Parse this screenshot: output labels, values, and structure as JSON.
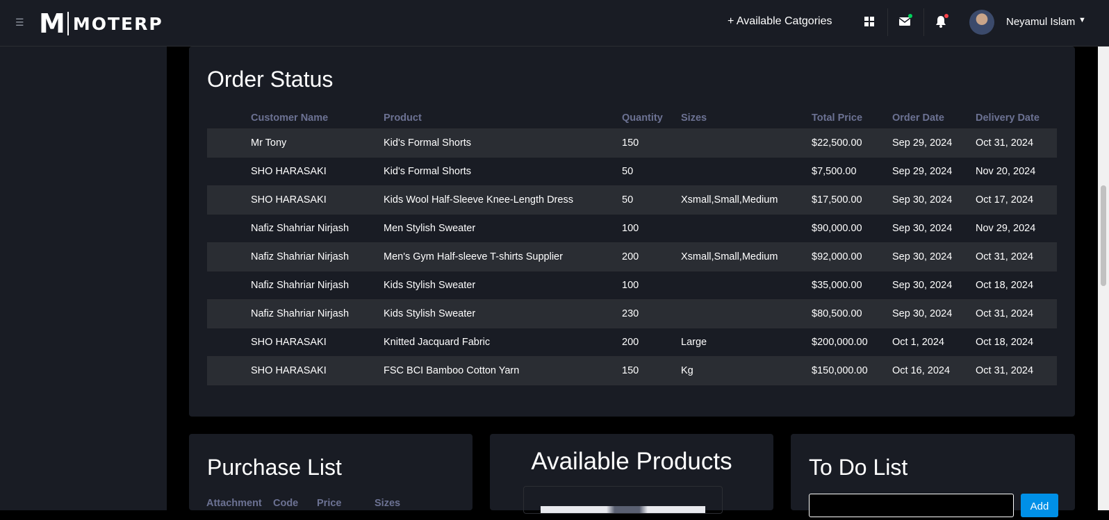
{
  "header": {
    "menu_icon": "hamburger-icon",
    "logo_mark": "M",
    "logo_text": "MOTERP",
    "available_categories": "+ Available Catgories",
    "icons": [
      "grid-icon",
      "mail-icon",
      "bell-icon"
    ],
    "user_name": "Neyamul Islam"
  },
  "order_status": {
    "title": "Order Status",
    "columns": [
      "Customer Name",
      "Product",
      "Quantity",
      "Sizes",
      "Total Price",
      "Order Date",
      "Delivery Date"
    ],
    "rows": [
      {
        "customer": "Mr Tony",
        "product": "Kid's Formal Shorts",
        "quantity": "150",
        "sizes": "",
        "total": "$22,500.00",
        "order_date": "Sep 29, 2024",
        "delivery_date": "Oct 31, 2024"
      },
      {
        "customer": "SHO HARASAKI",
        "product": "Kid's Formal Shorts",
        "quantity": "50",
        "sizes": "",
        "total": "$7,500.00",
        "order_date": "Sep 29, 2024",
        "delivery_date": "Nov 20, 2024"
      },
      {
        "customer": "SHO HARASAKI",
        "product": "Kids Wool Half-Sleeve Knee-Length Dress",
        "quantity": "50",
        "sizes": "Xsmall,Small,Medium",
        "total": "$17,500.00",
        "order_date": "Sep 30, 2024",
        "delivery_date": "Oct 17, 2024"
      },
      {
        "customer": "Nafiz Shahriar Nirjash",
        "product": "Men Stylish Sweater",
        "quantity": "100",
        "sizes": "",
        "total": "$90,000.00",
        "order_date": "Sep 30, 2024",
        "delivery_date": "Nov 29, 2024"
      },
      {
        "customer": "Nafiz Shahriar Nirjash",
        "product": "Men's Gym Half-sleeve T-shirts Supplier",
        "quantity": "200",
        "sizes": "Xsmall,Small,Medium",
        "total": "$92,000.00",
        "order_date": "Sep 30, 2024",
        "delivery_date": "Oct 31, 2024"
      },
      {
        "customer": "Nafiz Shahriar Nirjash",
        "product": "Kids Stylish Sweater",
        "quantity": "100",
        "sizes": "",
        "total": "$35,000.00",
        "order_date": "Sep 30, 2024",
        "delivery_date": "Oct 18, 2024"
      },
      {
        "customer": "Nafiz Shahriar Nirjash",
        "product": "Kids Stylish Sweater",
        "quantity": "230",
        "sizes": "",
        "total": "$80,500.00",
        "order_date": "Sep 30, 2024",
        "delivery_date": "Oct 31, 2024"
      },
      {
        "customer": "SHO HARASAKI",
        "product": "Knitted Jacquard Fabric",
        "quantity": "200",
        "sizes": "Large",
        "total": "$200,000.00",
        "order_date": "Oct 1, 2024",
        "delivery_date": "Oct 18, 2024"
      },
      {
        "customer": "SHO HARASAKI",
        "product": "FSC BCI Bamboo Cotton Yarn",
        "quantity": "150",
        "sizes": "Kg",
        "total": "$150,000.00",
        "order_date": "Oct 16, 2024",
        "delivery_date": "Oct 31, 2024"
      }
    ]
  },
  "purchase_list": {
    "title": "Purchase List",
    "columns": [
      "Attachment",
      "Code",
      "Price",
      "Sizes"
    ]
  },
  "available_products": {
    "title": "Available Products"
  },
  "todo_list": {
    "title": "To Do List",
    "input_value": "",
    "add_label": "Add"
  },
  "colors": {
    "card_bg": "#191c24",
    "page_bg": "#000000",
    "muted_text": "#6c7293",
    "accent": "#0090e7",
    "mail_dot": "#00d25b",
    "bell_dot": "#fc424a"
  }
}
